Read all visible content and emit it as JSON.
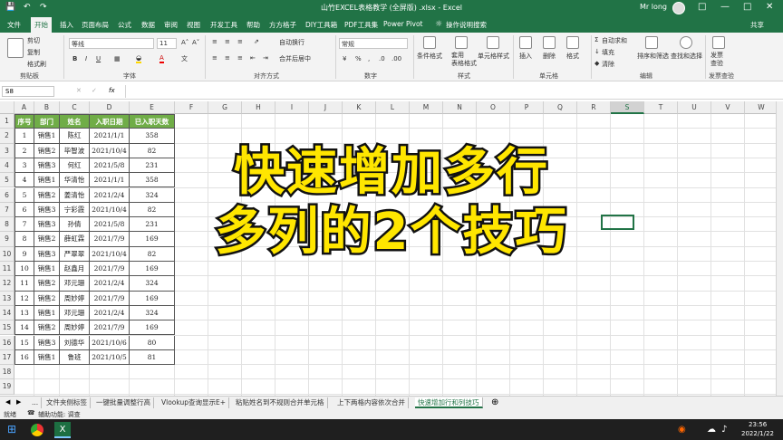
{
  "titlebar": {
    "title": "山竹EXCEL表格教学 (全屏版) .xlsx - Excel",
    "user": "Mr long"
  },
  "tabs": [
    "文件",
    "开始",
    "插入",
    "页面布局",
    "公式",
    "数据",
    "审阅",
    "视图",
    "开发工具",
    "帮助",
    "方方格子",
    "DIY工具箱",
    "PDF工具集",
    "Power Pivot",
    "操作说明搜索"
  ],
  "active_tab": "开始",
  "share": "共享",
  "ribbon": {
    "clipboard": {
      "cut": "剪切",
      "copy": "复制",
      "painter": "格式刷",
      "label": "剪贴板"
    },
    "font": {
      "name": "等线",
      "size": "11",
      "label": "字体"
    },
    "align": {
      "wrap": "自动换行",
      "merge": "合并后居中",
      "label": "对齐方式"
    },
    "number": {
      "format": "常规",
      "label": "数字"
    },
    "styles": {
      "cond": "条件格式",
      "table": "套用\n表格格式",
      "cell": "单元格样式",
      "label": "样式"
    },
    "cells": {
      "insert": "插入",
      "delete": "删除",
      "format": "格式",
      "label": "单元格"
    },
    "editing": {
      "autosum": "自动求和",
      "fill": "填充",
      "clear": "清除",
      "sort": "排序和筛选",
      "find": "查找和选择",
      "label": "编辑"
    },
    "invoice": {
      "check": "发票\n查验",
      "label": "发票查验"
    }
  },
  "formula_bar": {
    "name_box": "S8",
    "fx": "fx",
    "value": ""
  },
  "columns": [
    "A",
    "B",
    "C",
    "D",
    "E",
    "F",
    "G",
    "H",
    "I",
    "J",
    "K",
    "L",
    "M",
    "N",
    "O",
    "P",
    "Q",
    "R",
    "S",
    "T",
    "U",
    "V",
    "W"
  ],
  "selected_column": "S",
  "rows": [
    "1",
    "2",
    "3",
    "4",
    "5",
    "6",
    "7",
    "8",
    "9",
    "10",
    "11",
    "12",
    "13",
    "14",
    "15",
    "16",
    "17",
    "18",
    "19"
  ],
  "table": {
    "headers": [
      "序号",
      "部门",
      "姓名",
      "入职日期",
      "已入职天数"
    ],
    "data": [
      [
        "1",
        "销售1",
        "陈红",
        "2021/1/1",
        "358"
      ],
      [
        "2",
        "销售2",
        "毕智波",
        "2021/10/4",
        "82"
      ],
      [
        "3",
        "销售3",
        "何红",
        "2021/5/8",
        "231"
      ],
      [
        "4",
        "销售1",
        "华清怡",
        "2021/1/1",
        "358"
      ],
      [
        "5",
        "销售2",
        "姜清怡",
        "2021/2/4",
        "324"
      ],
      [
        "6",
        "销售3",
        "宁彩霞",
        "2021/10/4",
        "82"
      ],
      [
        "7",
        "销售3",
        "孙倩",
        "2021/5/8",
        "231"
      ],
      [
        "8",
        "销售2",
        "薛虹霖",
        "2021/7/9",
        "169"
      ],
      [
        "9",
        "销售3",
        "严翠翠",
        "2021/10/4",
        "82"
      ],
      [
        "10",
        "销售1",
        "赵鑫月",
        "2021/7/9",
        "169"
      ],
      [
        "11",
        "销售2",
        "邓元珊",
        "2021/2/4",
        "324"
      ],
      [
        "12",
        "销售2",
        "周妙婷",
        "2021/7/9",
        "169"
      ],
      [
        "13",
        "销售1",
        "邓元珊",
        "2021/2/4",
        "324"
      ],
      [
        "14",
        "销售2",
        "周妙婷",
        "2021/7/9",
        "169"
      ],
      [
        "15",
        "销售3",
        "刘德华",
        "2021/10/6",
        "80"
      ],
      [
        "16",
        "销售1",
        "鲁班",
        "2021/10/5",
        "81"
      ]
    ]
  },
  "overlay": {
    "line1": "快速增加多行",
    "line2": "多列的2个技巧"
  },
  "sheets": [
    "...",
    "文件夹侧标签",
    "一键批量调整行高",
    "Vlookup查询显示E+",
    "粘贴姓名到不规则合并单元格",
    "上下两格内容依次合并",
    "快速增加行和列技巧"
  ],
  "active_sheet": "快速增加行和列技巧",
  "status": {
    "ready": "就绪",
    "accessibility": "辅助功能: 调查"
  },
  "taskbar": {
    "time": "23:56",
    "date": "2022/1/22"
  }
}
